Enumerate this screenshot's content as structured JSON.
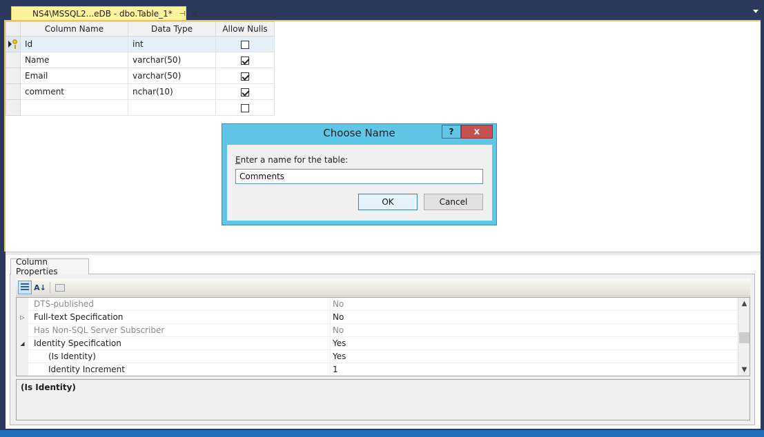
{
  "document_tab": {
    "title": "NS4\\MSSQL2...eDB - dbo.Table_1*",
    "pin_glyph": "⊣",
    "close_glyph": "✕"
  },
  "grid": {
    "headers": [
      "Column Name",
      "Data Type",
      "Allow Nulls"
    ],
    "rows": [
      {
        "name": "Id",
        "type": "int",
        "nulls": false
      },
      {
        "name": "Name",
        "type": "varchar(50)",
        "nulls": true
      },
      {
        "name": "Email",
        "type": "varchar(50)",
        "nulls": true
      },
      {
        "name": "comment",
        "type": "nchar(10)",
        "nulls": true
      },
      {
        "name": "",
        "type": "",
        "nulls": false
      }
    ]
  },
  "properties": {
    "tab_label": "Column Properties",
    "rows": [
      {
        "name": "DTS-published",
        "value": "No",
        "expander": "",
        "dim": true
      },
      {
        "name": "Full-text Specification",
        "value": "No",
        "expander": "▷",
        "dim": false
      },
      {
        "name": "Has Non-SQL Server Subscriber",
        "value": "No",
        "expander": "",
        "dim": true
      },
      {
        "name": "Identity Specification",
        "value": "Yes",
        "expander": "◢",
        "dim": false
      },
      {
        "name": "(Is Identity)",
        "value": "Yes",
        "expander": "",
        "dim": false,
        "sub": true
      },
      {
        "name": "Identity Increment",
        "value": "1",
        "expander": "",
        "dim": false,
        "sub": true
      }
    ],
    "description_title": "(Is Identity)"
  },
  "dialog": {
    "title": "Choose Name",
    "help_label": "?",
    "close_label": "x",
    "prompt_accel": "E",
    "prompt_rest": "nter a name for the table:",
    "input_value": "Comments",
    "ok_label": "OK",
    "cancel_label": "Cancel"
  },
  "colors": {
    "tab_active": "#fff29d",
    "dialog_frame": "#5fc6e8",
    "close_button": "#c75050",
    "status_bar": "#1e6fb8"
  }
}
